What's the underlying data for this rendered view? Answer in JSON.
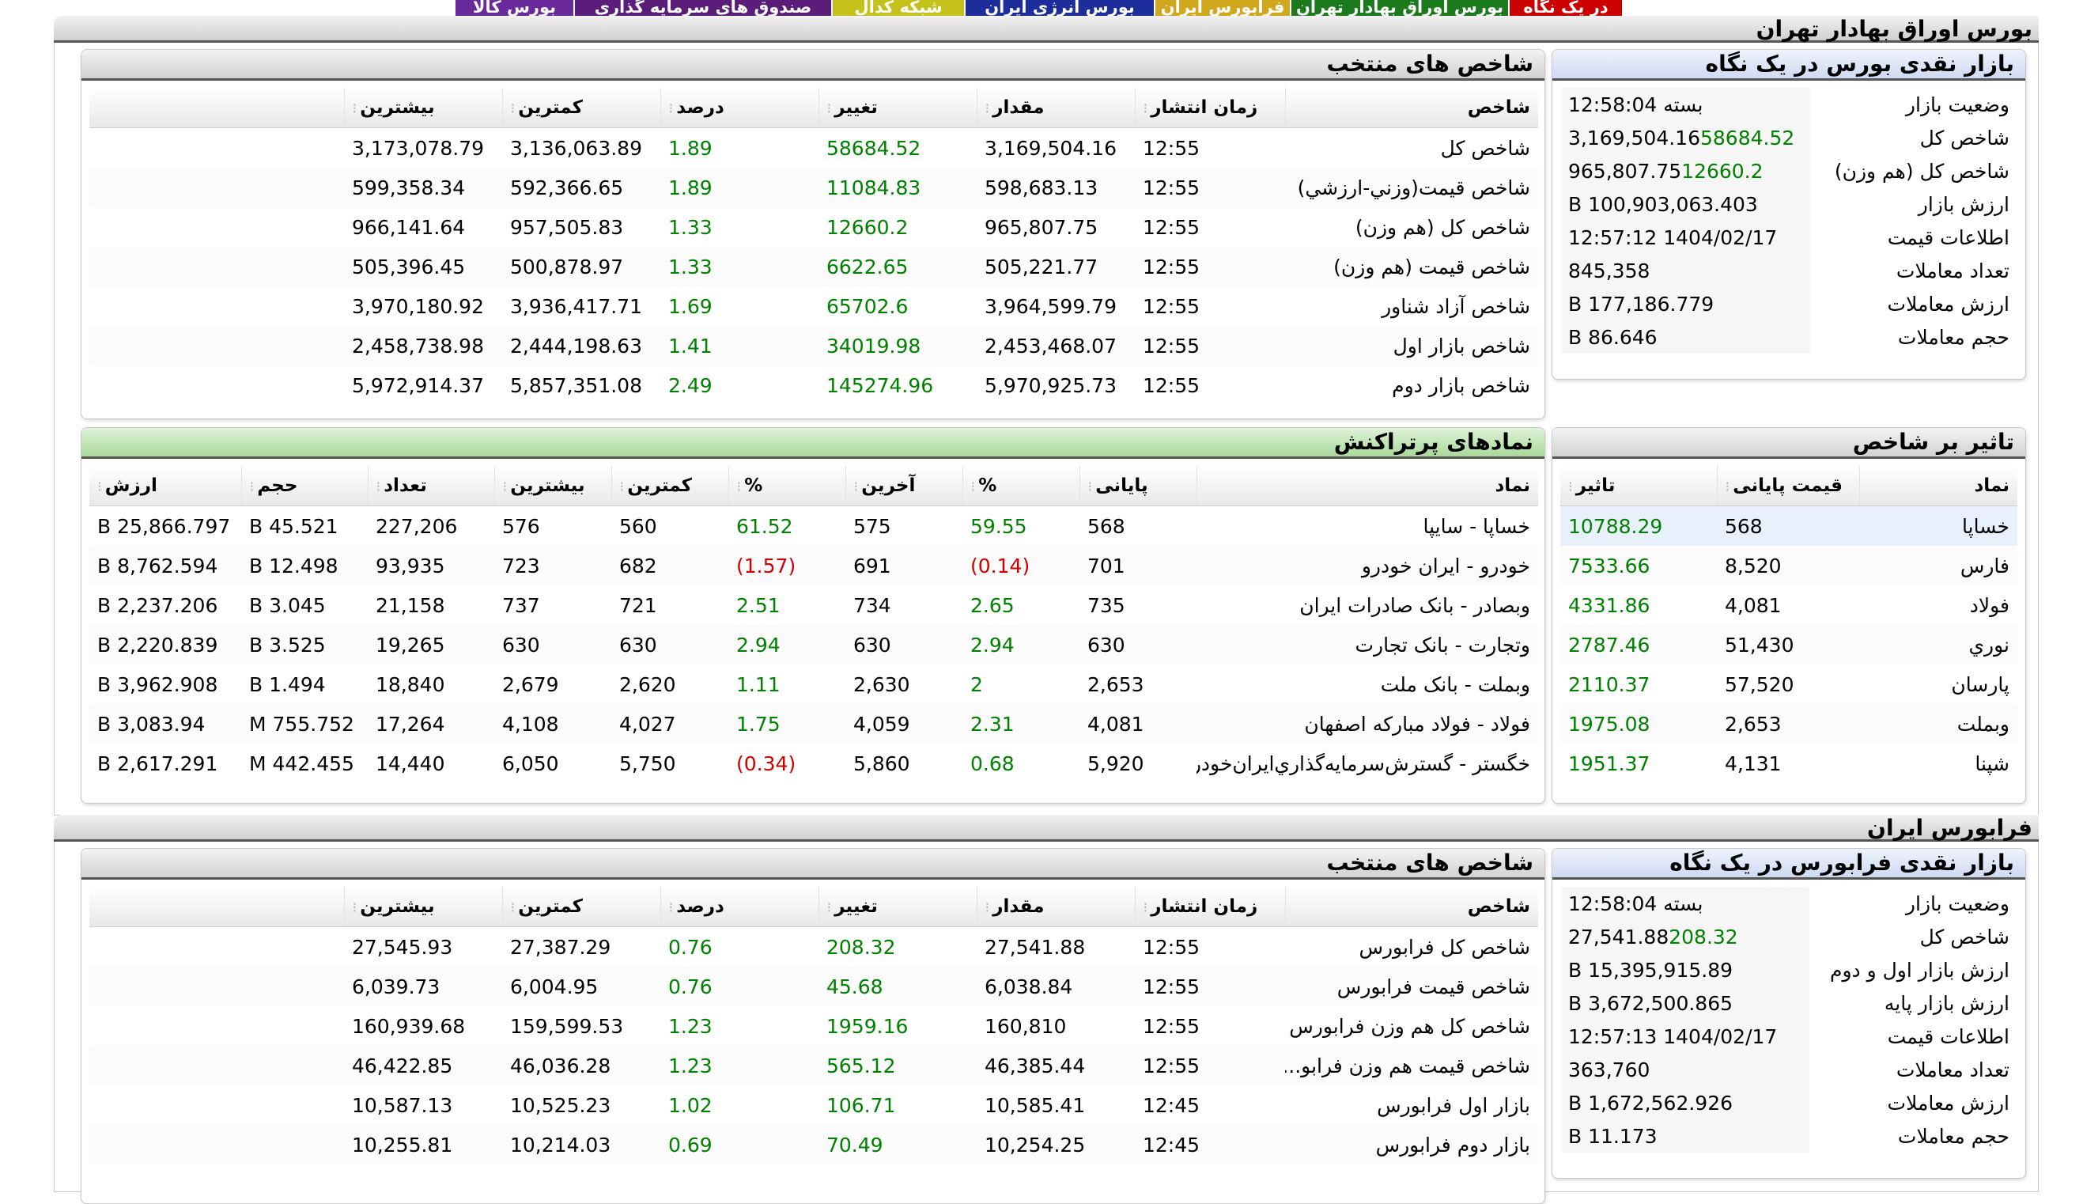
{
  "tabs": [
    "در یک نگاه",
    "بورس اوراق بهادار تهران",
    "فرابورس ایران",
    "بورس انرژی ایران",
    "شبکه کدال",
    "صندوق های سرمایه گذاری",
    "بورس کالا"
  ],
  "colors": {
    "positive": "#008000",
    "negative": "#cc0000",
    "header_blue": "#cfdaf2",
    "header_green": "#a9d99a"
  },
  "tse": {
    "title": "بورس اوراق بهادار تهران",
    "summary": {
      "title": "بازار نقدی بورس در یک نگاه",
      "rows": [
        {
          "label": "وضعیت بازار",
          "value": "بسته 12:58:04",
          "change": ""
        },
        {
          "label": "شاخص کل",
          "value": "3,169,504.16",
          "change": "58684.52"
        },
        {
          "label": "شاخص کل (هم وزن)",
          "value": "965,807.75",
          "change": "12660.2"
        },
        {
          "label": "ارزش بازار",
          "value": "100,903,063.403 B",
          "change": ""
        },
        {
          "label": "اطلاعات قیمت",
          "value": "1404/02/17 12:57:12",
          "change": ""
        },
        {
          "label": "تعداد معاملات",
          "value": "845,358",
          "change": ""
        },
        {
          "label": "ارزش معاملات",
          "value": "177,186.779 B",
          "change": ""
        },
        {
          "label": "حجم معاملات",
          "value": "86.646 B",
          "change": ""
        }
      ]
    },
    "indices": {
      "title": "شاخص های منتخب",
      "columns": [
        "شاخص",
        "زمان انتشار",
        "مقدار",
        "تغییر",
        "درصد",
        "کمترین",
        "بیشترین"
      ],
      "rows": [
        [
          "شاخص کل",
          "12:55",
          "3,169,504.16",
          "58684.52",
          "1.89",
          "3,136,063.89",
          "3,173,078.79"
        ],
        [
          "شاخص قيمت(وزني-ارزشي)",
          "12:55",
          "598,683.13",
          "11084.83",
          "1.89",
          "592,366.65",
          "599,358.34"
        ],
        [
          "شاخص کل (هم وزن)",
          "12:55",
          "965,807.75",
          "12660.2",
          "1.33",
          "957,505.83",
          "966,141.64"
        ],
        [
          "شاخص قیمت (هم وزن)",
          "12:55",
          "505,221.77",
          "6622.65",
          "1.33",
          "500,878.97",
          "505,396.45"
        ],
        [
          "شاخص آزاد شناور",
          "12:55",
          "3,964,599.79",
          "65702.6",
          "1.69",
          "3,936,417.71",
          "3,970,180.92"
        ],
        [
          "شاخص بازار اول",
          "12:55",
          "2,453,468.07",
          "34019.98",
          "1.41",
          "2,444,198.63",
          "2,458,738.98"
        ],
        [
          "شاخص بازار دوم",
          "12:55",
          "5,970,925.73",
          "145274.96",
          "2.49",
          "5,857,351.08",
          "5,972,914.37"
        ]
      ]
    },
    "impact": {
      "title": "تاثیر بر شاخص",
      "columns": [
        "نماد",
        "قیمت پایانی",
        "تاثیر"
      ],
      "rows": [
        [
          "خساپا",
          "568",
          "10788.29"
        ],
        [
          "فارس",
          "8,520",
          "7533.66"
        ],
        [
          "فولاد",
          "4,081",
          "4331.86"
        ],
        [
          "نوري",
          "51,430",
          "2787.46"
        ],
        [
          "پارسان",
          "57,520",
          "2110.37"
        ],
        [
          "وبملت",
          "2,653",
          "1975.08"
        ],
        [
          "شپنا",
          "4,131",
          "1951.37"
        ]
      ]
    },
    "active": {
      "title": "نمادهای پرتراکنش",
      "columns": [
        "نماد",
        "پایانی",
        "%",
        "آخرین",
        "%",
        "کمترین",
        "بیشترین",
        "تعداد",
        "حجم",
        "ارزش"
      ],
      "rows": [
        [
          "خساپا - سايپا",
          "568",
          "59.55",
          "575",
          "61.52",
          "560",
          "576",
          "227,206",
          "45.521 B",
          "25,866.797 B"
        ],
        [
          "خودرو - ایران‌ خودرو",
          "701",
          "(0.14)",
          "691",
          "(1.57)",
          "682",
          "723",
          "93,935",
          "12.498 B",
          "8,762.594 B"
        ],
        [
          "وبصادر - بانک صادرات ایران",
          "735",
          "2.65",
          "734",
          "2.51",
          "721",
          "737",
          "21,158",
          "3.045 B",
          "2,237.206 B"
        ],
        [
          "وتجارت - بانک تجارت",
          "630",
          "2.94",
          "630",
          "2.94",
          "630",
          "630",
          "19,265",
          "3.525 B",
          "2,220.839 B"
        ],
        [
          "وبملت - بانک ملت",
          "2,653",
          "2",
          "2,630",
          "1.11",
          "2,620",
          "2,679",
          "18,840",
          "1.494 B",
          "3,962.908 B"
        ],
        [
          "فولاد - فولاد مباركه اصفهان",
          "4,081",
          "2.31",
          "4,059",
          "1.75",
          "4,027",
          "4,108",
          "17,264",
          "755.752 M",
          "3,083.94 B"
        ],
        [
          "خگستر - گسترش‌سرمايه‌گذاري‌ايران‌خودرو",
          "5,920",
          "0.68",
          "5,860",
          "(0.34)",
          "5,750",
          "6,050",
          "14,440",
          "442.455 M",
          "2,617.291 B"
        ]
      ]
    }
  },
  "ifb": {
    "title": "فرابورس ایران",
    "summary": {
      "title": "بازار نقدی فرابورس در یک نگاه",
      "rows": [
        {
          "label": "وضعیت بازار",
          "value": "بسته 12:58:04",
          "change": ""
        },
        {
          "label": "شاخص کل",
          "value": "27,541.88",
          "change": "208.32"
        },
        {
          "label": "ارزش بازار اول و دوم",
          "value": "15,395,915.89 B",
          "change": ""
        },
        {
          "label": "ارزش بازار پایه",
          "value": "3,672,500.865 B",
          "change": ""
        },
        {
          "label": "اطلاعات قیمت",
          "value": "1404/02/17 12:57:13",
          "change": ""
        },
        {
          "label": "تعداد معاملات",
          "value": "363,760",
          "change": ""
        },
        {
          "label": "ارزش معاملات",
          "value": "1,672,562.926 B",
          "change": ""
        },
        {
          "label": "حجم معاملات",
          "value": "11.173 B",
          "change": ""
        }
      ]
    },
    "indices": {
      "title": "شاخص های منتخب",
      "columns": [
        "شاخص",
        "زمان انتشار",
        "مقدار",
        "تغییر",
        "درصد",
        "کمترین",
        "بیشترین"
      ],
      "rows": [
        [
          "شاخص کل فرابورس",
          "12:55",
          "27,541.88",
          "208.32",
          "0.76",
          "27,387.29",
          "27,545.93"
        ],
        [
          "شاخص قیمت فرابورس",
          "12:55",
          "6,038.84",
          "45.68",
          "0.76",
          "6,004.95",
          "6,039.73"
        ],
        [
          "شاخص کل هم وزن فرابورس",
          "12:55",
          "160,810",
          "1959.16",
          "1.23",
          "159,599.53",
          "160,939.68"
        ],
        [
          "شاخص قیمت هم وزن فرابو...",
          "12:55",
          "46,385.44",
          "565.12",
          "1.23",
          "46,036.28",
          "46,422.85"
        ],
        [
          "بازار اول فرابورس",
          "12:45",
          "10,585.41",
          "106.71",
          "1.02",
          "10,525.23",
          "10,587.13"
        ],
        [
          "بازار دوم فرابورس",
          "12:45",
          "10,254.25",
          "70.49",
          "0.69",
          "10,214.03",
          "10,255.81"
        ]
      ]
    }
  }
}
